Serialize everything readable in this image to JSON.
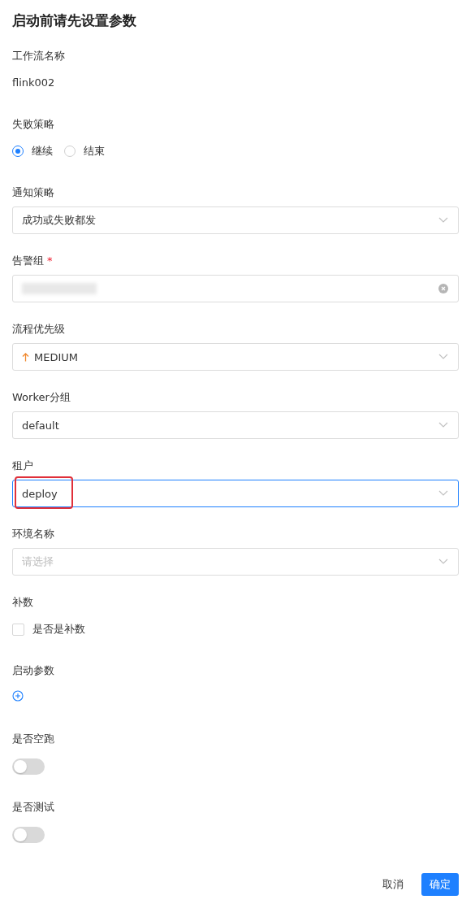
{
  "title": "启动前请先设置参数",
  "fields": [
    {
      "kind": "text",
      "label": "工作流名称",
      "value": "flink002"
    },
    {
      "kind": "radio",
      "label": "失败策略",
      "options": [
        {
          "label": "继续",
          "selected": true
        },
        {
          "label": "结束",
          "selected": false
        }
      ]
    },
    {
      "kind": "select",
      "label": "通知策略",
      "value": "成功或失败都发",
      "focused": false
    },
    {
      "kind": "select",
      "label": "告警组",
      "required_mark": "*",
      "redacted": true,
      "clearable": true,
      "focused": false
    },
    {
      "kind": "select",
      "label": "流程优先级",
      "value": "MEDIUM",
      "priority_icon": true,
      "focused": false
    },
    {
      "kind": "select",
      "label": "Worker分组",
      "value": "default",
      "focused": false
    },
    {
      "kind": "select",
      "label": "租户",
      "value": "deploy",
      "focused": true,
      "highlighted": true
    },
    {
      "kind": "select",
      "label": "环境名称",
      "placeholder": "请选择",
      "focused": false
    },
    {
      "kind": "checkbox",
      "label": "补数",
      "option": "是否是补数",
      "checked": false
    },
    {
      "kind": "add",
      "label": "启动参数"
    },
    {
      "kind": "switch",
      "label": "是否空跑",
      "on": false
    },
    {
      "kind": "switch",
      "label": "是否测试",
      "on": false
    }
  ],
  "buttons": {
    "cancel": "取消",
    "confirm": "确定"
  }
}
